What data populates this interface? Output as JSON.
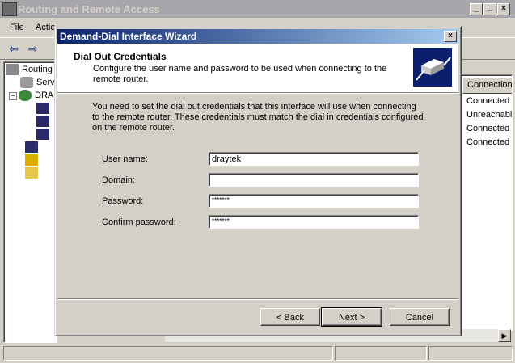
{
  "background_window": {
    "title": "Routing and Remote Access",
    "menu": [
      "File",
      "Actio"
    ],
    "tree": [
      {
        "label": "Routing"
      },
      {
        "label": "Serv"
      },
      {
        "label": "DRA"
      }
    ],
    "list": {
      "column_header": "Connection",
      "rows": [
        "Connected",
        "Unreachabl",
        "Connected",
        "Connected"
      ]
    }
  },
  "dialog": {
    "title": "Demand-Dial Interface Wizard",
    "header_title": "Dial Out Credentials",
    "header_subtitle": "Configure the user name and password to be used when connecting to the remote router.",
    "intro": "You need to set the dial out credentials that this interface will use when connecting to the remote router.  These credentials must match the dial in credentials configured on the remote router.",
    "fields": {
      "user_name": {
        "label": "User name:",
        "value": "draytek"
      },
      "domain": {
        "label": "Domain:",
        "value": ""
      },
      "password": {
        "label": "Password:",
        "value": "*******"
      },
      "confirm_password": {
        "label": "Confirm password:",
        "value": "*******"
      }
    },
    "buttons": {
      "back": "< Back",
      "next": "Next >",
      "cancel": "Cancel"
    }
  },
  "colors": {
    "title_active_start": "#0a246a",
    "title_active_end": "#a6caf0",
    "title_inactive": "#a7a6aa",
    "face": "#d4d0c8"
  }
}
